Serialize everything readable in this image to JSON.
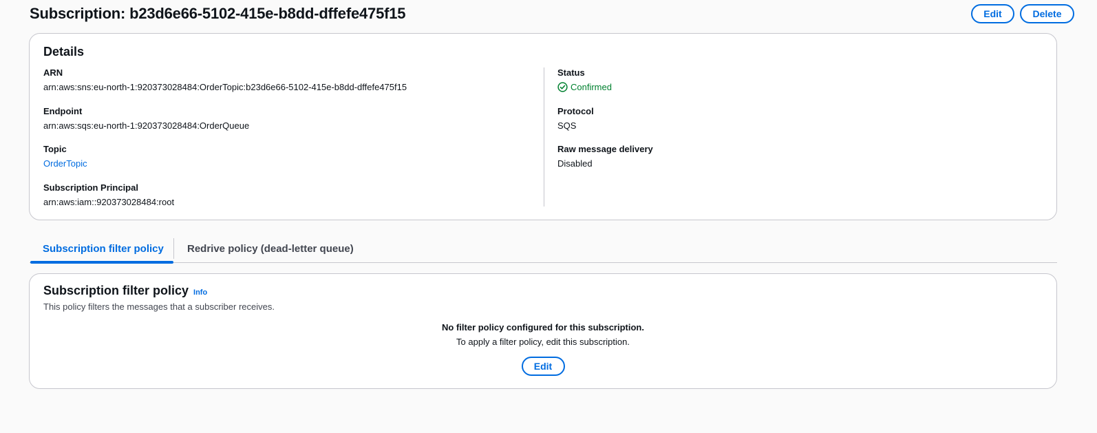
{
  "header": {
    "title": "Subscription: b23d6e66-5102-415e-b8dd-dffefe475f15",
    "edit_label": "Edit",
    "delete_label": "Delete"
  },
  "details": {
    "title": "Details",
    "left": [
      {
        "label": "ARN",
        "value": "arn:aws:sns:eu-north-1:920373028484:OrderTopic:b23d6e66-5102-415e-b8dd-dffefe475f15"
      },
      {
        "label": "Endpoint",
        "value": "arn:aws:sqs:eu-north-1:920373028484:OrderQueue"
      },
      {
        "label": "Topic",
        "value": "OrderTopic"
      },
      {
        "label": "Subscription Principal",
        "value": "arn:aws:iam::920373028484:root"
      }
    ],
    "right": [
      {
        "label": "Status",
        "value": "Confirmed",
        "icon": "check-circle-icon",
        "color": "#00802f"
      },
      {
        "label": "Protocol",
        "value": "SQS"
      },
      {
        "label": "Raw message delivery",
        "value": "Disabled"
      }
    ]
  },
  "tabs": [
    {
      "label": "Subscription filter policy",
      "active": true
    },
    {
      "label": "Redrive policy (dead-letter queue)",
      "active": false
    }
  ],
  "filter_policy": {
    "title": "Subscription filter policy",
    "info_label": "Info",
    "description": "This policy filters the messages that a subscriber receives.",
    "empty_title": "No filter policy configured for this subscription.",
    "empty_description": "To apply a filter policy, edit this subscription.",
    "edit_label": "Edit"
  },
  "colors": {
    "accent": "#006ce0",
    "success": "#00802f",
    "border": "#c6c6cd"
  }
}
